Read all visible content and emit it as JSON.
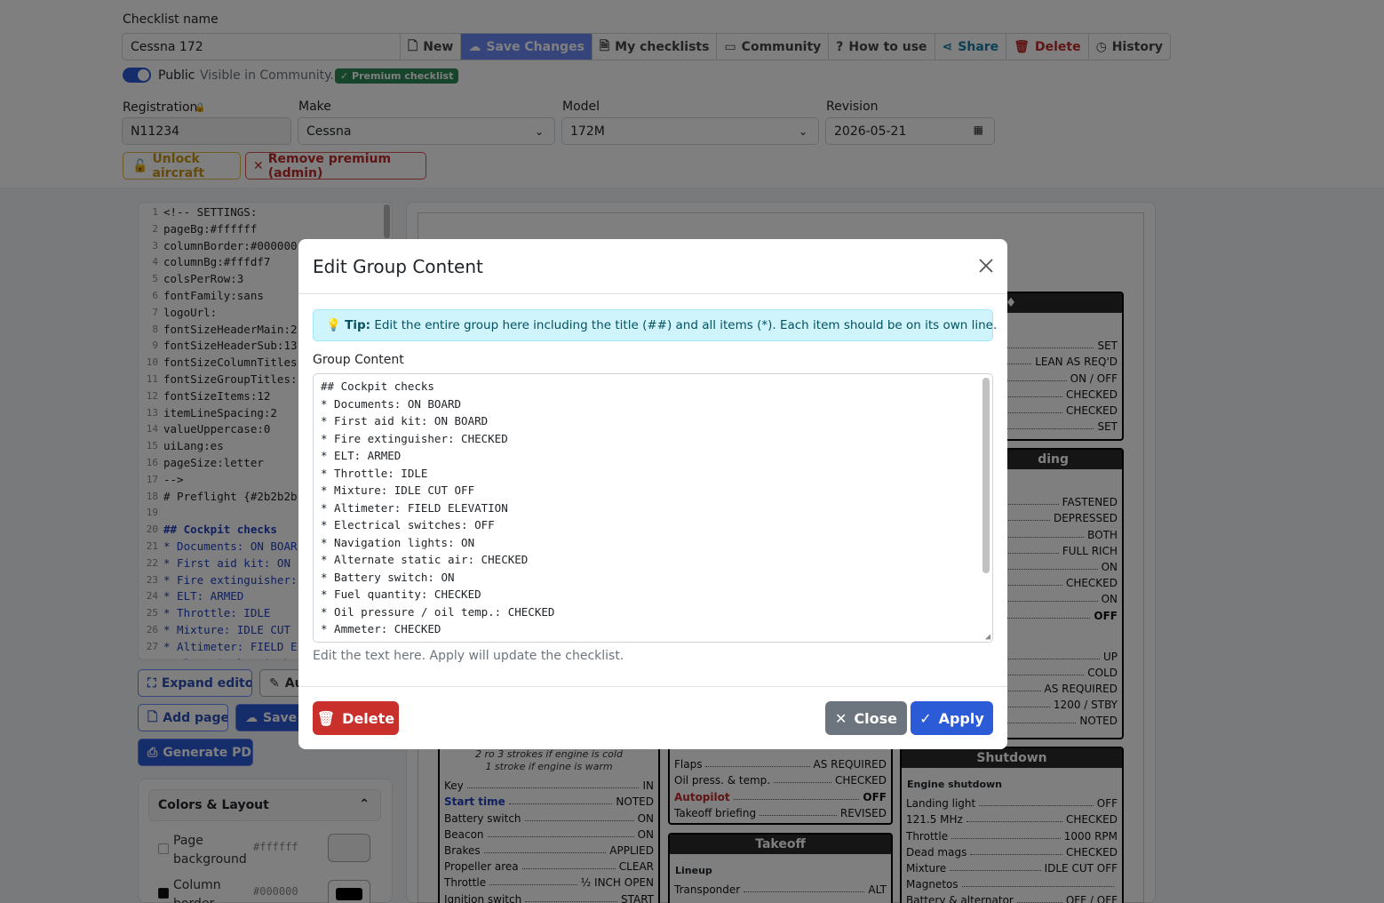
{
  "header": {
    "checklist_name_label": "Checklist name",
    "checklist_name_value": "Cessna 172",
    "toolbar": [
      {
        "label": "New",
        "icon": "file-icon"
      },
      {
        "label": "Save Changes",
        "icon": "cloud-upload-icon"
      },
      {
        "label": "My checklists",
        "icon": "document-icon"
      },
      {
        "label": "Community",
        "icon": "folder-icon"
      },
      {
        "label": "How to use",
        "icon": "question-circle-icon"
      },
      {
        "label": "Share",
        "icon": "share-icon"
      },
      {
        "label": "Delete",
        "icon": "trash-icon"
      },
      {
        "label": "History",
        "icon": "clock-icon"
      }
    ],
    "public_label": "Public",
    "public_hint": "Visible in Community.",
    "premium_badge": "✓ Premium checklist",
    "registration_label": "Registration",
    "registration_value": "N11234",
    "make_label": "Make",
    "make_value": "Cessna",
    "model_label": "Model",
    "model_value": "172M",
    "revision_label": "Revision",
    "revision_value": "2026-05-21",
    "unlock_label": "Unlock aircraft",
    "remove_premium_label": "Remove premium (admin)"
  },
  "editor": {
    "lines": [
      "<!-- SETTINGS:",
      "pageBg:#ffffff",
      "columnBorder:#000000",
      "columnBg:#fffdf7",
      "colsPerRow:3",
      "fontFamily:sans",
      "logoUrl:",
      "fontSizeHeaderMain:2",
      "fontSizeHeaderSub:13",
      "fontSizeColumnTitles",
      "fontSizeGroupTitles:",
      "fontSizeItems:12",
      "itemLineSpacing:2",
      "valueUppercase:0",
      "uiLang:es",
      "pageSize:letter",
      "-->",
      "# Preflight {#2b2b2b",
      "",
      "## Cockpit checks",
      "* Documents: ON BOAR",
      "* First aid kit: ON",
      "* Fire extinguisher:",
      "* ELT: ARMED",
      "* Throttle: IDLE",
      "* Mixture: IDLE CUT",
      "* Altimeter: FIELD E",
      "* Electrical switch"
    ],
    "expand_label": "Expand editor",
    "auto_label": "Au",
    "add_page_label": "Add page",
    "save_label": "Save C",
    "pdf_label": "Generate PDF"
  },
  "layout_panel": {
    "title": "Colors & Layout",
    "rows": [
      {
        "label": "Page background",
        "value": "#ffffff",
        "swatch": "#ffffff"
      },
      {
        "label": "Column border",
        "value": "#000000",
        "swatch": "#000000"
      }
    ]
  },
  "preview": {
    "col3_top_values": [
      "SET",
      "LEAN AS REQ'D",
      "ON / OFF",
      "CHECKED",
      "CHECKED",
      "SET"
    ],
    "col3_mid_header": "ding",
    "col3_mid_values": [
      "FASTENED",
      "DEPRESSED",
      "BOTH",
      "FULL RICH",
      "ON",
      "CHECKED",
      "ON",
      "OFF"
    ],
    "col3_low_values": [
      "UP",
      "COLD",
      "AS REQUIRED",
      "1200 / STBY",
      "NOTED"
    ],
    "col1_notes": [
      "2 ro 3 strokes if engine is cold",
      "1 stroke if engine is warm"
    ],
    "col1_items": [
      {
        "k": "Key",
        "v": "IN"
      },
      {
        "k": "Start time",
        "v": "NOTED"
      },
      {
        "k": "Battery switch",
        "v": "ON"
      },
      {
        "k": "Beacon",
        "v": "ON"
      },
      {
        "k": "Brakes",
        "v": "APPLIED"
      },
      {
        "k": "Propeller area",
        "v": "CLEAR"
      },
      {
        "k": "Throttle",
        "v": "½ INCH OPEN"
      },
      {
        "k": "Ignition switch",
        "v": "START"
      }
    ],
    "col2_items": [
      {
        "k": "Flaps",
        "v": "AS REQUIRED"
      },
      {
        "k": "Oil press. & temp.",
        "v": "CHECKED"
      },
      {
        "k": "Autopilot",
        "v": "OFF"
      },
      {
        "k": "Takeoff briefing",
        "v": "REVISED"
      }
    ],
    "takeoff_header": "Takeoff",
    "takeoff_sub": "Lineup",
    "takeoff_items": [
      {
        "k": "Transponder",
        "v": "ALT"
      }
    ],
    "shutdown_header": "Shutdown",
    "shutdown_sub": "Engine shutdown",
    "shutdown_items": [
      {
        "k": "Landing light",
        "v": "OFF"
      },
      {
        "k": "121.5 MHz",
        "v": "CHECKED"
      },
      {
        "k": "Throttle",
        "v": "1000 RPM"
      },
      {
        "k": "Dead mags",
        "v": "CHECKED"
      },
      {
        "k": "Mixture",
        "v": "IDLE CUT OFF"
      },
      {
        "k": "Magnetos",
        "v": ""
      },
      {
        "k": "Battery & alternator",
        "v": "OFF / OFF"
      }
    ]
  },
  "modal": {
    "title": "Edit Group Content",
    "tip_bold": "Tip:",
    "tip_text": "Edit the entire group here including the title (##) and all items (*). Each item should be on its own line.",
    "content_label": "Group Content",
    "content_lines": [
      "## Cockpit checks",
      "* Documents: ON BOARD",
      "* First aid kit: ON BOARD",
      "* Fire extinguisher: CHECKED",
      "* ELT: ARMED",
      "* Throttle: IDLE",
      "* Mixture: IDLE CUT OFF",
      "* Altimeter: FIELD ELEVATION",
      "* Electrical switches: OFF",
      "* Navigation lights: ON",
      "* Alternate static air: CHECKED",
      "* Battery switch: ON",
      "* Fuel quantity: CHECKED",
      "* Oil pressure / oil temp.: CHECKED",
      "* Ammeter: CHECKED"
    ],
    "help_text": "Edit the text here. Apply will update the checklist.",
    "delete_label": "Delete",
    "close_label": "Close",
    "apply_label": "Apply"
  },
  "colors": {
    "primary": "#2c5bd8",
    "danger": "#c9302c",
    "secondary": "#6c757d",
    "tip_bg": "#cff4fc"
  }
}
